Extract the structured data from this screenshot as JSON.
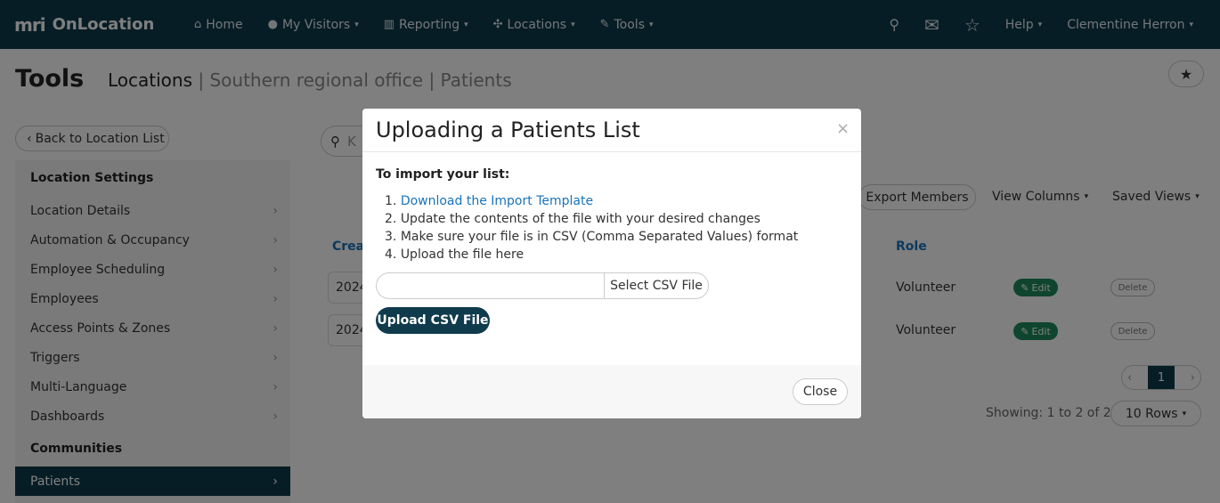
{
  "nav": {
    "brand_mark": "mri",
    "brand_name": "OnLocation",
    "items": [
      {
        "label": "Home",
        "icon": "home-icon"
      },
      {
        "label": "My Visitors",
        "icon": "user-icon"
      },
      {
        "label": "Reporting",
        "icon": "chart-icon"
      },
      {
        "label": "Locations",
        "icon": "network-icon"
      },
      {
        "label": "Tools",
        "icon": "wrench-icon"
      }
    ],
    "help_label": "Help",
    "user_name": "Clementine Herron"
  },
  "page": {
    "title": "Tools",
    "crumb_main": "Locations",
    "crumb_rest": "| Southern regional office | Patients",
    "back_label": "Back to Location List"
  },
  "sidebar": {
    "section1": "Location Settings",
    "items": [
      "Location Details",
      "Automation & Occupancy",
      "Employee Scheduling",
      "Employees",
      "Access Points & Zones",
      "Triggers",
      "Multi-Language",
      "Dashboards"
    ],
    "section2": "Communities",
    "active_item": "Patients"
  },
  "toolbar": {
    "search_partial": "K",
    "export_label": "Export Members",
    "view_columns_label": "View Columns",
    "saved_views_label": "Saved Views"
  },
  "table": {
    "col_created": "Crea",
    "col_role": "Role",
    "rows": [
      {
        "created": "2024",
        "role": "Volunteer",
        "edit": "Edit",
        "delete": "Delete"
      },
      {
        "created": "2024",
        "role": "Volunteer",
        "edit": "Edit",
        "delete": "Delete"
      }
    ],
    "page_current": "1",
    "showing": "Showing: 1 to 2 of 2",
    "rows_label": "10 Rows"
  },
  "modal": {
    "title": "Uploading a Patients List",
    "import_label": "To import your list:",
    "steps": [
      "Download the Import Template",
      "Update the contents of the file with your desired changes",
      "Make sure your file is in CSV (Comma Separated Values) format",
      "Upload the file here"
    ],
    "select_label": "Select CSV File",
    "upload_label": "Upload CSV File",
    "close_label": "Close",
    "close_x": "×"
  }
}
